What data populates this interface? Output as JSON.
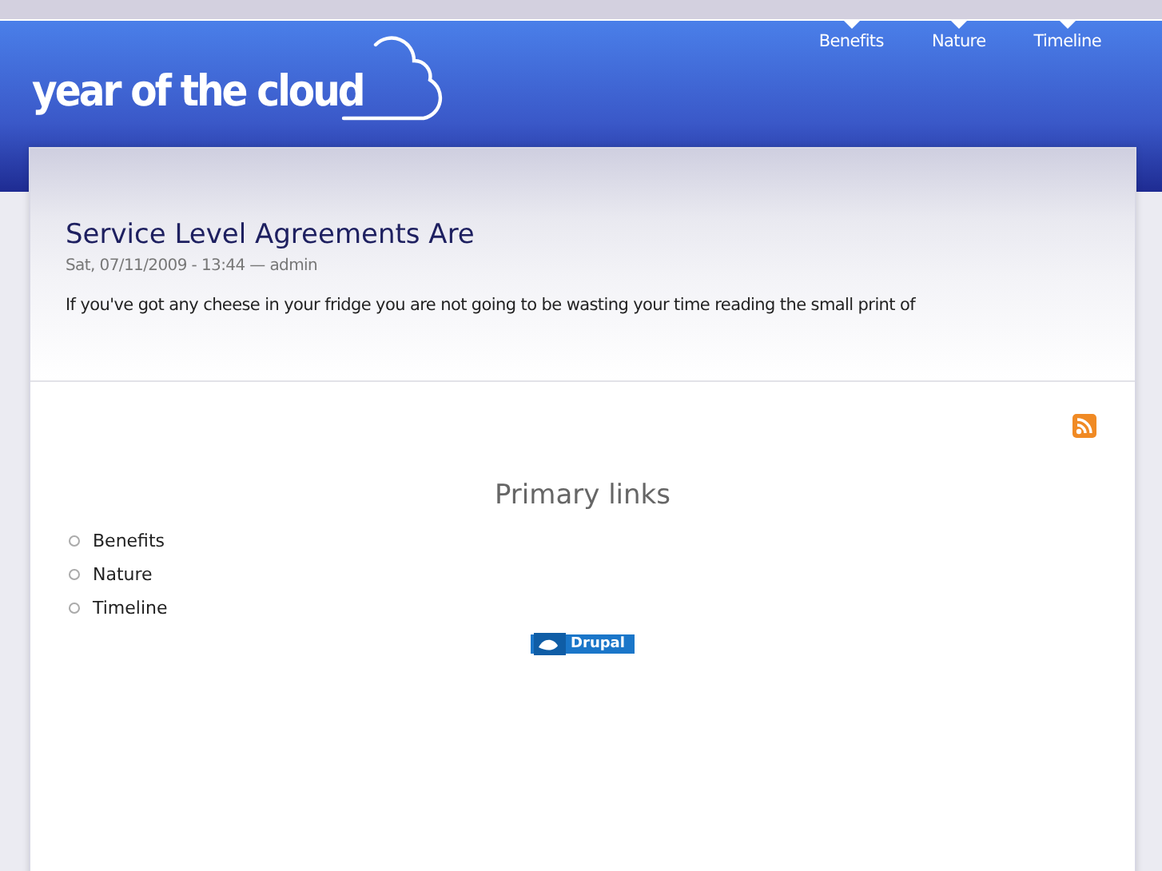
{
  "site": {
    "logo": "year of the cloud"
  },
  "nav": [
    {
      "label": "Benefits"
    },
    {
      "label": "Nature"
    },
    {
      "label": "Timeline"
    }
  ],
  "post": {
    "title": "Service Level Agreements Are",
    "meta": "Sat, 07/11/2009 - 13:44 — admin",
    "body": "If you've got any cheese in your fridge you are not going to be wasting your time reading the small print of"
  },
  "block": {
    "title": "Primary links",
    "links": [
      "Benefits",
      "Nature",
      "Timeline"
    ]
  },
  "badge": {
    "label": "Drupal"
  }
}
